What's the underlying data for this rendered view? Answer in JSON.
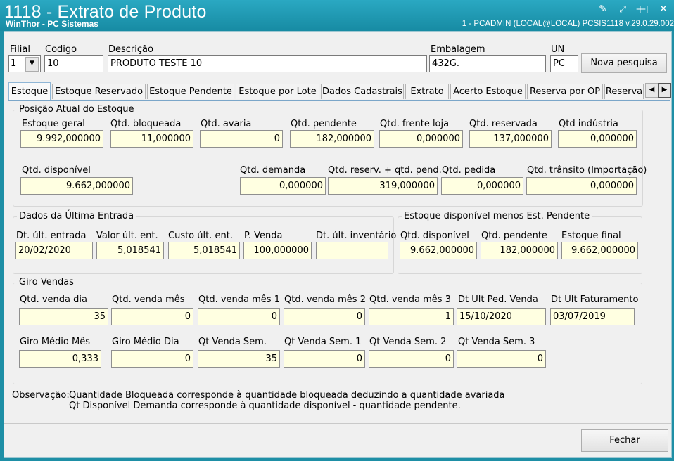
{
  "window": {
    "title": "1118 - Extrato de Produto",
    "subtitle": "WinThor - PC Sistemas",
    "connection": "1 - PCADMIN (LOCAL@LOCAL)  PCSIS1118  v.29.0.29.002"
  },
  "header": {
    "filial_label": "Filial",
    "filial_value": "1",
    "codigo_label": "Codigo",
    "codigo_value": "10",
    "descricao_label": "Descrição",
    "descricao_value": "PRODUTO TESTE 10",
    "embalagem_label": "Embalagem",
    "embalagem_value": "432G.",
    "un_label": "UN",
    "un_value": "PC",
    "nova_pesquisa_label": "Nova pesquisa"
  },
  "tabs": [
    "Estoque",
    "Estoque Reservado",
    "Estoque Pendente",
    "Estoque por Lote",
    "Dados Cadastrais",
    "Extrato",
    "Acerto Estoque",
    "Reserva por OP",
    "Reserva"
  ],
  "posicao": {
    "title": "Posição Atual do Estoque",
    "estoque_geral": {
      "label": "Estoque geral",
      "value": "9.992,000000"
    },
    "qtd_bloqueada": {
      "label": "Qtd. bloqueada",
      "value": "11,000000"
    },
    "qtd_avaria": {
      "label": "Qtd. avaria",
      "value": "0"
    },
    "qtd_pendente": {
      "label": "Qtd. pendente",
      "value": "182,000000"
    },
    "qtd_frente_loja": {
      "label": "Qtd. frente loja",
      "value": "0,000000"
    },
    "qtd_reservada": {
      "label": "Qtd. reservada",
      "value": "137,000000"
    },
    "qtd_industria": {
      "label": "Qtd indústria",
      "value": "0,000000"
    },
    "qtd_disponivel": {
      "label": "Qtd. disponível",
      "value": "9.662,000000"
    },
    "qtd_demanda": {
      "label": "Qtd. demanda",
      "value": "0,000000"
    },
    "qtd_reserv_pend": {
      "label": "Qtd. reserv. + qtd. pend.",
      "value": "319,000000"
    },
    "qtd_pedida": {
      "label": "Qtd. pedida",
      "value": "0,000000"
    },
    "qtd_transito": {
      "label": "Qtd. trânsito (Importação)",
      "value": "0,000000"
    }
  },
  "ultima_entrada": {
    "title": "Dados da Última Entrada",
    "dt_ult_entrada": {
      "label": "Dt. últ. entrada",
      "value": "20/02/2020"
    },
    "valor_ult_ent": {
      "label": "Valor últ. ent.",
      "value": "5,018541"
    },
    "custo_ult_ent": {
      "label": "Custo últ. ent.",
      "value": "5,018541"
    },
    "p_venda": {
      "label": "P. Venda",
      "value": "100,000000"
    },
    "dt_ult_inventario": {
      "label": "Dt. últ. inventário",
      "value": ""
    }
  },
  "disp_menos_pend": {
    "title": "Estoque disponível menos Est. Pendente",
    "qtd_disponivel": {
      "label": "Qtd. disponível",
      "value": "9.662,000000"
    },
    "qtd_pendente": {
      "label": "Qtd. pendente",
      "value": "182,000000"
    },
    "estoque_final": {
      "label": "Estoque final",
      "value": "9.662,000000"
    }
  },
  "giro": {
    "title": "Giro Vendas",
    "qtd_venda_dia": {
      "label": "Qtd. venda dia",
      "value": "35"
    },
    "qtd_venda_mes": {
      "label": "Qtd. venda mês",
      "value": "0"
    },
    "qtd_venda_mes1": {
      "label": "Qtd. venda mês 1",
      "value": "0"
    },
    "qtd_venda_mes2": {
      "label": "Qtd. venda mês 2",
      "value": "0"
    },
    "qtd_venda_mes3": {
      "label": "Qtd. venda mês 3",
      "value": "1"
    },
    "dt_ult_ped_venda": {
      "label": "Dt Ult Ped. Venda",
      "value": "15/10/2020"
    },
    "dt_ult_faturamento": {
      "label": "Dt Ult Faturamento",
      "value": "03/07/2019"
    },
    "giro_medio_mes": {
      "label": "Giro Médio Mês",
      "value": "0,333"
    },
    "giro_medio_dia": {
      "label": "Giro Médio Dia",
      "value": "0"
    },
    "qt_venda_sem": {
      "label": "Qt Venda Sem.",
      "value": "35"
    },
    "qt_venda_sem1": {
      "label": "Qt Venda Sem. 1",
      "value": "0"
    },
    "qt_venda_sem2": {
      "label": "Qt Venda Sem. 2",
      "value": "0"
    },
    "qt_venda_sem3": {
      "label": "Qt Venda Sem. 3",
      "value": "0"
    }
  },
  "observacao": {
    "label": "Observação:",
    "line1": "Quantidade Bloqueada corresponde à quantidade bloqueada deduzindo a quantidade avariada",
    "line2": "Qt Disponível Demanda corresponde à quantidade disponível - quantidade pendente."
  },
  "footer": {
    "fechar_label": "Fechar"
  }
}
